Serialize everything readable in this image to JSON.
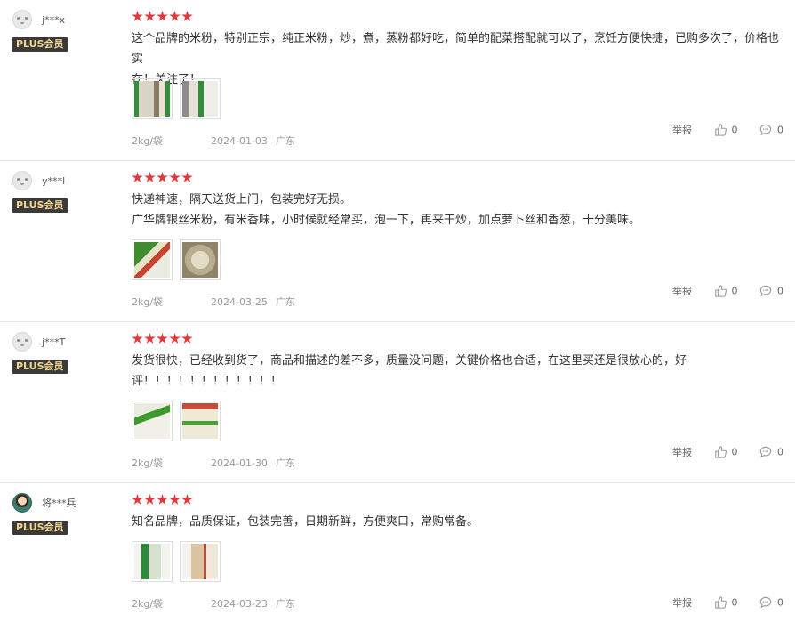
{
  "reviews": [
    {
      "user": "j***x",
      "avatar": "default-avatar",
      "badge": "PLUS会员",
      "stars": 5,
      "text": "这个品牌的米粉，特别正宗，纯正米粉，炒，煮，蒸粉都好吃，简单的配菜搭配就可以了，烹饪方便快捷，已购多次了，价格也实\n在！关注了！",
      "images": [
        "product-photo-1",
        "product-photo-2"
      ],
      "spec": "2kg/袋",
      "date": "2024-01-03",
      "region": "广东",
      "report": "举报",
      "likes": "0",
      "comments": "0"
    },
    {
      "user": "y***l",
      "avatar": "default-avatar",
      "badge": "PLUS会员",
      "stars": 5,
      "text": "快递神速，隔天送货上门，包装完好无损。\n广华牌银丝米粉，有米香味，小时候就经常买，泡一下，再来干炒，加点萝卜丝和香葱，十分美味。",
      "images": [
        "product-photo-3",
        "product-photo-4"
      ],
      "spec": "2kg/袋",
      "date": "2024-03-25",
      "region": "广东",
      "report": "举报",
      "likes": "0",
      "comments": "0"
    },
    {
      "user": "j***T",
      "avatar": "default-avatar",
      "badge": "PLUS会员",
      "stars": 5,
      "text": "发货很快，已经收到货了，商品和描述的差不多，质量没问题，关键价格也合适，在这里买还是很放心的，好\n评！！！！！！！！！！！！",
      "images": [
        "product-photo-5",
        "product-photo-6"
      ],
      "spec": "2kg/袋",
      "date": "2024-01-30",
      "region": "广东",
      "report": "举报",
      "likes": "0",
      "comments": "0"
    },
    {
      "user": "将***兵",
      "avatar": "photo-avatar",
      "badge": "PLUS会员",
      "stars": 5,
      "text": "知名品牌，品质保证，包装完善，日期新鲜，方便爽口，常购常备。",
      "images": [
        "product-photo-7",
        "product-photo-8"
      ],
      "spec": "2kg/袋",
      "date": "2024-03-23",
      "region": "广东",
      "report": "举报",
      "likes": "0",
      "comments": "0"
    }
  ],
  "colors": {
    "star": "#e4393c",
    "badge_bg": "#3a3a3a",
    "badge_text": "#f3d58c",
    "meta_text": "#999999",
    "divider": "#e5e5e5"
  }
}
